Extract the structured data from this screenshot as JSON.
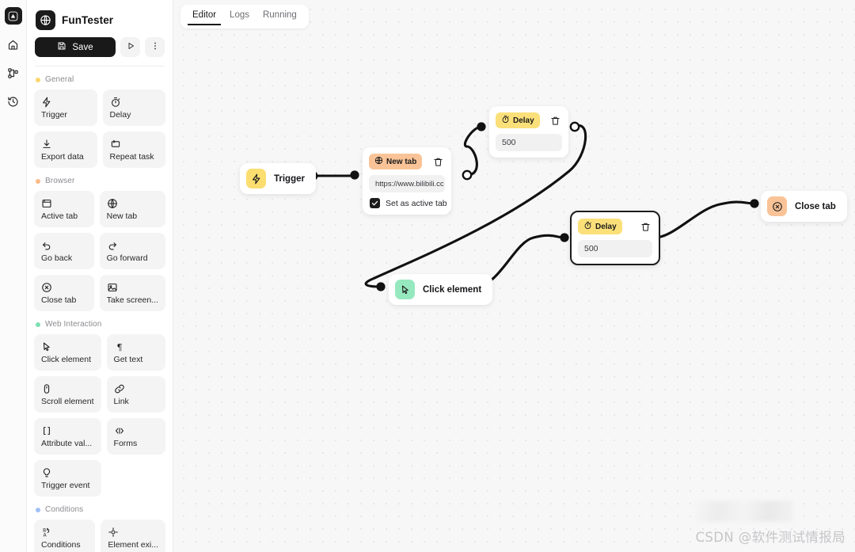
{
  "rail": {
    "logo_icon": "triangle-logo-icon",
    "items": [
      {
        "icon": "home-icon",
        "name": "rail-item-home"
      },
      {
        "icon": "workflow-icon",
        "name": "rail-item-workflows"
      },
      {
        "icon": "history-icon",
        "name": "rail-item-history"
      }
    ]
  },
  "sidebar": {
    "brand": {
      "name": "FunTester",
      "icon": "globe-icon"
    },
    "toolbar": {
      "save_label": "Save",
      "save_icon": "floppy-disk-icon",
      "run_icon": "play-icon",
      "more_icon": "kebab-menu-icon"
    },
    "groups": [
      {
        "title": "General",
        "dot_color": "#f8d66b",
        "blocks": [
          {
            "label": "Trigger",
            "icon": "lightning-icon"
          },
          {
            "label": "Delay",
            "icon": "timer-icon"
          },
          {
            "label": "Export data",
            "icon": "download-icon"
          },
          {
            "label": "Repeat task",
            "icon": "repeat-icon"
          }
        ]
      },
      {
        "title": "Browser",
        "dot_color": "#f9bb86",
        "blocks": [
          {
            "label": "Active tab",
            "icon": "window-icon"
          },
          {
            "label": "New tab",
            "icon": "globe-icon"
          },
          {
            "label": "Go back",
            "icon": "arrow-back-icon"
          },
          {
            "label": "Go forward",
            "icon": "arrow-forward-icon"
          },
          {
            "label": "Close tab",
            "icon": "x-circle-icon"
          },
          {
            "label": "Take screen...",
            "icon": "image-icon"
          }
        ]
      },
      {
        "title": "Web Interaction",
        "dot_color": "#7de0b4",
        "blocks": [
          {
            "label": "Click element",
            "icon": "cursor-icon"
          },
          {
            "label": "Get text",
            "icon": "pilcrow-icon"
          },
          {
            "label": "Scroll element",
            "icon": "mouse-icon"
          },
          {
            "label": "Link",
            "icon": "link-icon"
          },
          {
            "label": "Attribute val...",
            "icon": "brackets-icon"
          },
          {
            "label": "Forms",
            "icon": "form-input-icon"
          },
          {
            "label": "Trigger event",
            "icon": "bulb-icon"
          }
        ]
      },
      {
        "title": "Conditions",
        "dot_color": "#9ec1f5",
        "blocks": [
          {
            "label": "Conditions",
            "icon": "branch-icon"
          },
          {
            "label": "Element exi...",
            "icon": "target-icon"
          }
        ]
      }
    ]
  },
  "canvas": {
    "tabs": [
      {
        "label": "Editor",
        "active": true
      },
      {
        "label": "Logs",
        "active": false
      },
      {
        "label": "Running",
        "active": false
      }
    ],
    "nodes": [
      {
        "id": "trigger",
        "type": "simple",
        "title": "Trigger",
        "icon": "lightning-icon",
        "chip_color": "#fbdd70",
        "selected": false
      },
      {
        "id": "new-tab",
        "type": "card-newtab",
        "badge_label": "New tab",
        "badge_icon": "globe-icon",
        "badge_color": "#f9c397",
        "url_value": "https://www.bilibili.cc",
        "checkbox_label": "Set as active tab",
        "checkbox_checked": true,
        "delete_icon": "trash-icon",
        "selected": false
      },
      {
        "id": "delay-1",
        "type": "card-delay",
        "badge_label": "Delay",
        "badge_icon": "timer-icon",
        "badge_color": "#fbe07a",
        "delay_value": "500",
        "delete_icon": "trash-icon",
        "selected": false
      },
      {
        "id": "delay-2",
        "type": "card-delay",
        "badge_label": "Delay",
        "badge_icon": "timer-icon",
        "badge_color": "#fbe07a",
        "delay_value": "500",
        "delete_icon": "trash-icon",
        "selected": true
      },
      {
        "id": "click-element",
        "type": "simple",
        "title": "Click element",
        "icon": "cursor-icon",
        "chip_color": "#96e8bf",
        "selected": false
      },
      {
        "id": "close-tab",
        "type": "simple",
        "title": "Close tab",
        "icon": "x-circle-icon",
        "chip_color": "#f9c397",
        "selected": false
      }
    ]
  },
  "watermark": {
    "text": "CSDN @软件测试情报局"
  }
}
